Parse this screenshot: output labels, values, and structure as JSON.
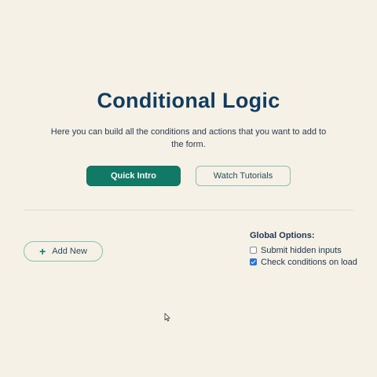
{
  "page": {
    "title": "Conditional Logic",
    "description": "Here you can build all the conditions and actions that you want to add to the form."
  },
  "actions": {
    "quick_intro": "Quick Intro",
    "watch_tutorials": "Watch Tutorials",
    "add_new": "Add New"
  },
  "global_options": {
    "title": "Global Options:",
    "options": [
      {
        "label": "Submit hidden inputs",
        "checked": false
      },
      {
        "label": "Check conditions on load",
        "checked": true
      }
    ]
  },
  "colors": {
    "background": "#f6f1e6",
    "primary": "#117a66",
    "title": "#123c5e",
    "checkbox_checked": "#2b74d6"
  },
  "icons": {
    "add": "plus-icon",
    "pointer": "mouse-cursor-icon"
  }
}
